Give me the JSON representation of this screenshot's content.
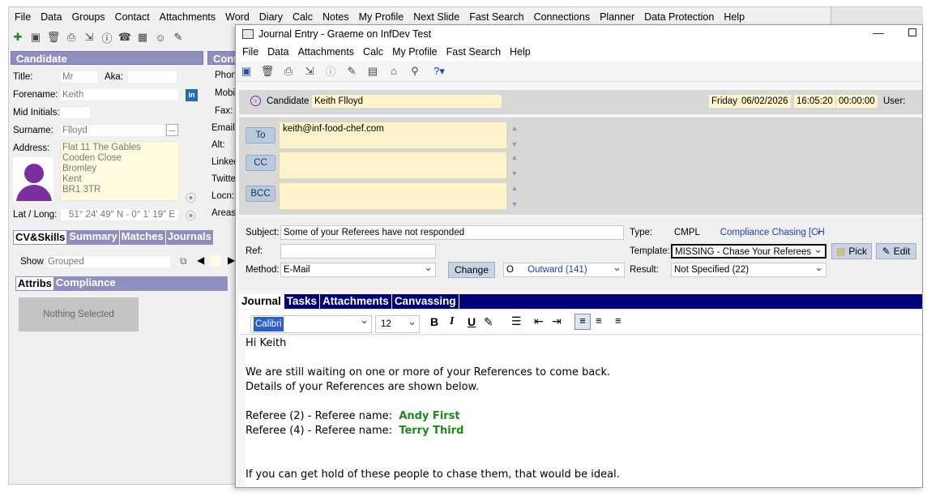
{
  "main_menu": [
    "File",
    "Data",
    "Groups",
    "Contact",
    "Attachments",
    "Word",
    "Diary",
    "Calc",
    "Notes",
    "My Profile",
    "Next Slide",
    "Fast Search",
    "Connections",
    "Planner",
    "Data Protection",
    "Help"
  ],
  "candidate": {
    "header": "Candidate",
    "contact_header": "Cont",
    "title_label": "Title:",
    "title_value": "Mr",
    "aka_label": "Aka:",
    "forename_label": "Forename:",
    "forename_value": "Keith",
    "mid_label": "Mid Initials:",
    "surname_label": "Surname:",
    "surname_value": "Flloyd",
    "address_label": "Address:",
    "address_lines": [
      "Flat 11 The Gables",
      "Cooden Close",
      "Bromley",
      "Kent",
      "BR1 3TR"
    ],
    "latlong_label": "Lat / Long:",
    "latlong_value": "51° 24' 49\" N - 0° 1' 19\" E",
    "contact_labels": [
      "Phone",
      "Mobil",
      "Fax:",
      "Email:",
      "Alt:",
      "Linked",
      "Twitter",
      "Locn:",
      "Areas:"
    ],
    "tabs": [
      "CV&Skills",
      "Summary",
      "Matches",
      "Journals"
    ],
    "show_label": "Show",
    "show_value": "Grouped",
    "subtabs": [
      "Attribs",
      "Compliance"
    ],
    "nothing_selected": "Nothing Selected"
  },
  "dialog": {
    "title": "Journal Entry - Graeme on InfDev Test",
    "menu": [
      "File",
      "Data",
      "Attachments",
      "Calc",
      "My Profile",
      "Fast Search",
      "Help"
    ],
    "candidate_label": "Candidate :",
    "candidate_value": "Keith Flloyd",
    "day": "Friday",
    "date": "06/02/2026",
    "time": "16:05:20",
    "duration": "00:00:00",
    "user_label": "User:",
    "to_label": "To",
    "to_value": "keith@inf-food-chef.com",
    "cc_label": "CC",
    "bcc_label": "BCC",
    "subject_label": "Subject:",
    "subject_value": "Some of your Referees have not responded",
    "type_label": "Type:",
    "type_code": "CMPL",
    "type_desc": "Compliance Chasing [CH",
    "ref_label": "Ref:",
    "template_label": "Template:",
    "template_value": "MISSING - Chase Your Referees",
    "pick_label": "Pick",
    "edit_label": "Edit",
    "method_label": "Method:",
    "method_value": "E-Mail",
    "change_label": "Change",
    "direction_code": "O",
    "direction_value": "Outward (141)",
    "result_label": "Result:",
    "result_value": "Not Specified (22)",
    "tabs": [
      "Journal",
      "Tasks",
      "Attachments",
      "Canvassing"
    ],
    "font_name": "Calibri",
    "font_size": "12",
    "body": {
      "greeting": "Hi Keith",
      "line1": "We are still waiting on one or more of your References to come back.",
      "line2": "Details of your References are shown below.",
      "ref1_label": "Referee (2) - Referee name:",
      "ref1_name": "Andy First",
      "ref2_label": "Referee (4) - Referee name:",
      "ref2_name": "Terry Third",
      "line3": "If you can get hold of these people to chase them, that would be ideal."
    }
  }
}
